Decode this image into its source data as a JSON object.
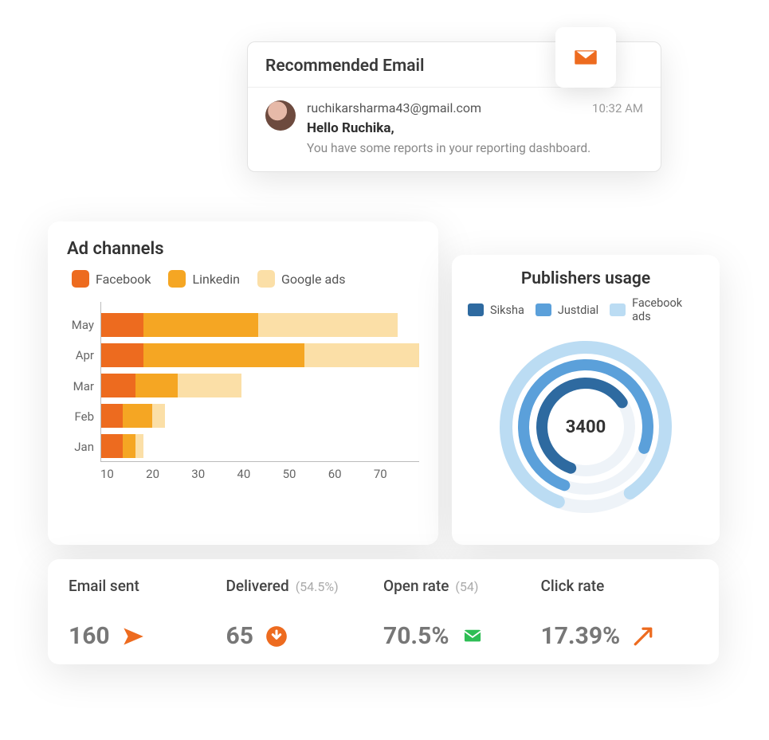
{
  "colors": {
    "orange_dark": "#ED6B1F",
    "orange_mid": "#F5A623",
    "orange_light": "#FBDFA7",
    "blue_dark": "#2E6AA0",
    "blue_mid": "#5BA0DA",
    "blue_light": "#BBDCF3",
    "green": "#2EBE55",
    "grey_text": "#7A7A7A"
  },
  "email": {
    "header": "Recommended Email",
    "address": "ruchikarsharma43@gmail.com",
    "time": "10:32 AM",
    "greeting": "Hello Ruchika,",
    "snippet": "You have some reports in your reporting dashboard."
  },
  "adChannels": {
    "title": "Ad channels",
    "legend": [
      "Facebook",
      "Linkedin",
      "Google ads"
    ]
  },
  "chart_data": {
    "type": "bar",
    "orientation": "horizontal",
    "stacked": true,
    "title": "Ad channels",
    "xlabel": "",
    "ylabel": "",
    "xlim": [
      0,
      75
    ],
    "xticks": [
      10,
      20,
      30,
      40,
      50,
      60,
      70
    ],
    "categories": [
      "May",
      "Apr",
      "Mar",
      "Feb",
      "Jan"
    ],
    "series": [
      {
        "name": "Facebook",
        "color": "#ED6B1F",
        "values": [
          10,
          10,
          8,
          5,
          5
        ]
      },
      {
        "name": "Linkedin",
        "color": "#F5A623",
        "values": [
          27,
          38,
          10,
          7,
          3
        ]
      },
      {
        "name": "Google ads",
        "color": "#FBDFA7",
        "values": [
          33,
          27,
          15,
          3,
          2
        ]
      }
    ]
  },
  "publishers": {
    "title": "Publishers usage",
    "legend": [
      "Siksha",
      "Justdial",
      "Facebook ads"
    ],
    "center_value": "3400",
    "rings": [
      {
        "name": "Siksha",
        "color": "#2E6AA0",
        "fraction": 0.6
      },
      {
        "name": "Justdial",
        "color": "#5BA0DA",
        "fraction": 0.75
      },
      {
        "name": "Facebook ads",
        "color": "#BBDCF3",
        "fraction": 0.85
      }
    ]
  },
  "stats": {
    "sent": {
      "label": "Email sent",
      "sub": "",
      "value": "160",
      "icon": "send-icon",
      "icon_color": "#ED6B1F"
    },
    "delivered": {
      "label": "Delivered",
      "sub": "(54.5%)",
      "value": "65",
      "icon": "down-circle-icon",
      "icon_color": "#ED6B1F"
    },
    "open": {
      "label": "Open rate",
      "sub": "(54)",
      "value": "70.5%",
      "icon": "envelope-icon",
      "icon_color": "#2EBE55"
    },
    "click": {
      "label": "Click rate",
      "sub": "",
      "value": "17.39%",
      "icon": "arrow-up-icon",
      "icon_color": "#ED6B1F"
    }
  }
}
